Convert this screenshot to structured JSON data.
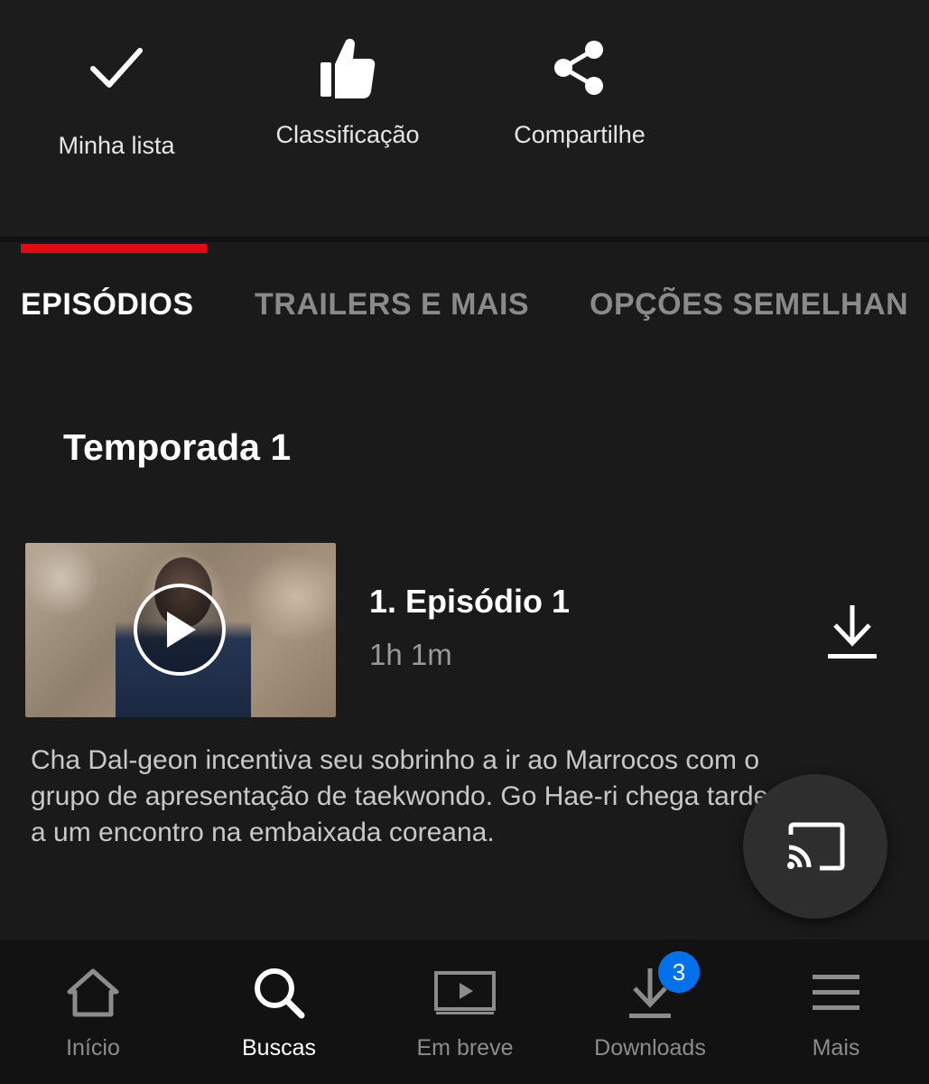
{
  "actions": {
    "my_list": {
      "label": "Minha lista",
      "icon": "check-icon"
    },
    "rating": {
      "label": "Classificação",
      "icon": "thumbs-up-icon"
    },
    "share": {
      "label": "Compartilhe",
      "icon": "share-icon"
    }
  },
  "tabs": [
    {
      "label": "EPISÓDIOS",
      "active": true
    },
    {
      "label": "TRAILERS E MAIS",
      "active": false
    },
    {
      "label": "OPÇÕES SEMELHAN",
      "active": false
    }
  ],
  "season": {
    "label": "Temporada 1"
  },
  "episode": {
    "title": "1. Episódio 1",
    "duration": "1h 1m",
    "synopsis": "Cha Dal-geon incentiva seu sobrinho a ir ao Marrocos com o grupo de apresentação de taekwondo. Go Hae-ri chega tarde a um encontro na embaixada coreana."
  },
  "bottom_nav": {
    "items": [
      {
        "label": "Início",
        "icon": "home-icon",
        "active": false
      },
      {
        "label": "Buscas",
        "icon": "search-icon",
        "active": true
      },
      {
        "label": "Em breve",
        "icon": "coming-soon-icon",
        "active": false
      },
      {
        "label": "Downloads",
        "icon": "download-icon",
        "active": false,
        "badge": "3"
      },
      {
        "label": "Mais",
        "icon": "menu-icon",
        "active": false
      }
    ]
  },
  "colors": {
    "accent": "#e50914",
    "badge": "#0071eb",
    "background": "#1a1a1a"
  }
}
